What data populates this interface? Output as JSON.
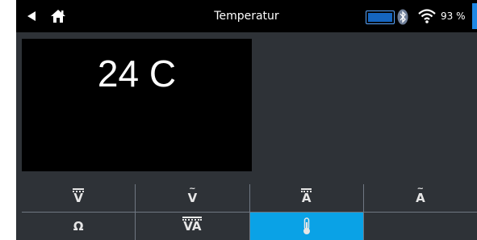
{
  "header": {
    "title": "Temperatur",
    "signal_percent": "93 %",
    "icons": [
      "back-arrow-icon",
      "home-icon",
      "battery-icon",
      "bluetooth-icon",
      "wifi-icon"
    ],
    "accent_color": "#1565c0"
  },
  "reading": {
    "value": "24 C"
  },
  "modes": [
    {
      "label": "V",
      "icon": "dc-voltage-icon",
      "active": false
    },
    {
      "label": "V",
      "icon": "ac-voltage-icon",
      "active": false
    },
    {
      "label": "A",
      "icon": "dc-current-icon",
      "active": false
    },
    {
      "label": "A",
      "icon": "ac-current-icon",
      "active": false
    },
    {
      "label": "Ω",
      "icon": "resistance-icon",
      "active": false
    },
    {
      "label": "VA",
      "icon": "volt-amp-icon",
      "active": false
    },
    {
      "label": "",
      "icon": "temperature-icon",
      "active": true
    },
    {
      "label": "",
      "icon": "",
      "active": false
    }
  ],
  "colors": {
    "active_mode": "#0aa2e6",
    "background": "#2e3237"
  }
}
